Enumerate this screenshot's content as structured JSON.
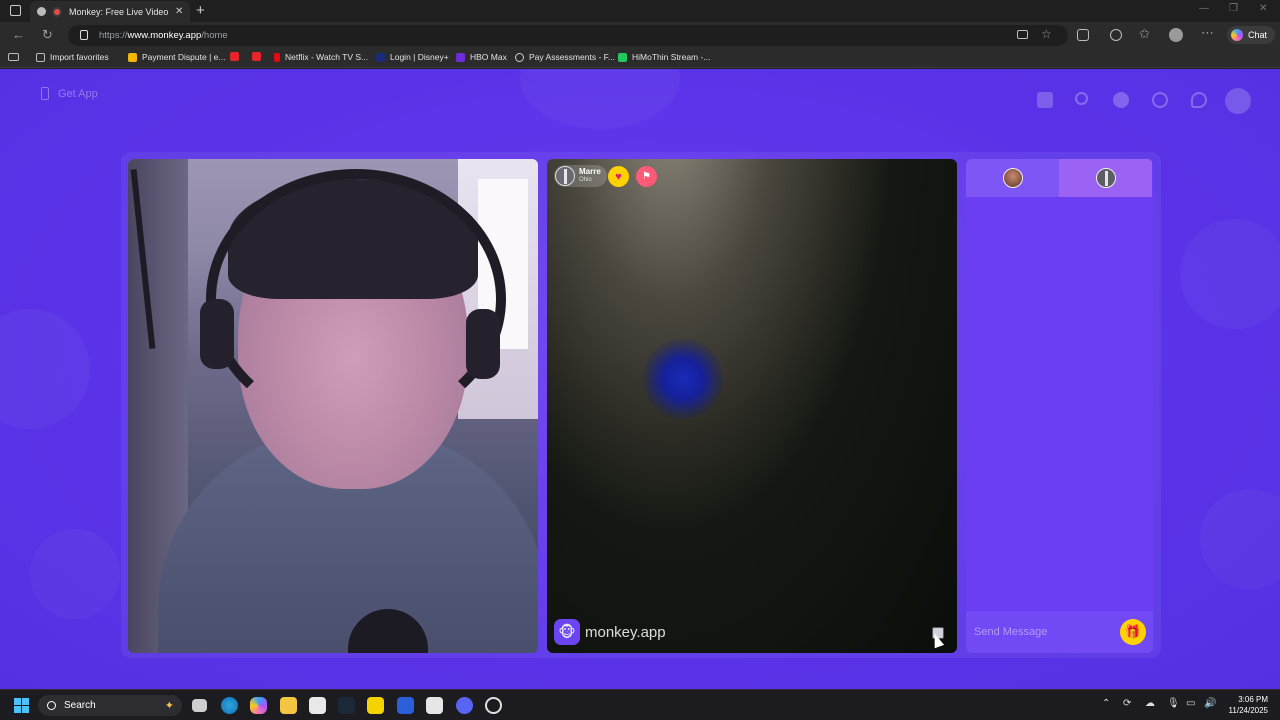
{
  "browser": {
    "tab_title": "Monkey: Free Live Video Ch",
    "tab_close": "✕",
    "new_tab": "+",
    "url_scheme": "https://",
    "url_host": "www.monkey.app",
    "url_path": "/home",
    "chat_label": "Chat",
    "window_controls": [
      "—",
      "❐",
      "✕"
    ]
  },
  "bookmarks": [
    {
      "label": "Import favorites",
      "color": "#9e9e9e"
    },
    {
      "label": "Payment Dispute | e...",
      "color": "#f2b705"
    },
    {
      "label": "",
      "color": "#e5252a"
    },
    {
      "label": "",
      "color": "#e5252a"
    },
    {
      "label": "Netflix - Watch TV S...",
      "color": "#e50914"
    },
    {
      "label": "Login | Disney+",
      "color": "#1b2a7a"
    },
    {
      "label": "HBO Max",
      "color": "#6d2bd9"
    },
    {
      "label": "Pay Assessments - F...",
      "color": "#9e9e9e"
    },
    {
      "label": "HiMoThin Stream -...",
      "color": "#22c55e"
    }
  ],
  "page": {
    "get_app_label": "Get App",
    "colors": {
      "background": "#5a33e8",
      "chat_panel": "#6b3ef4",
      "gift": "#ffd200"
    }
  },
  "peer": {
    "name": "Marre",
    "location": "Ohio",
    "heart_icon": "♥",
    "flag_icon": "⚑"
  },
  "watermark": {
    "logo_glyph": "🐵",
    "text": "monkey.app"
  },
  "chat": {
    "message_placeholder": "Send Message",
    "gift_icon": "🎁"
  },
  "taskbar": {
    "search_label": "Search",
    "time": "3:06 PM",
    "date": "11/24/2025"
  }
}
